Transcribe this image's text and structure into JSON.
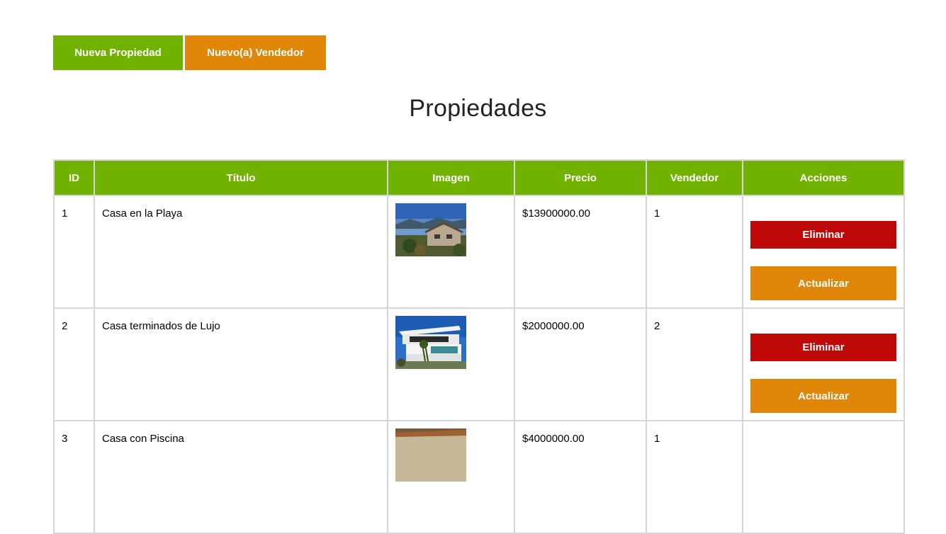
{
  "toolbar": {
    "new_property_label": "Nueva Propiedad",
    "new_seller_label": "Nuevo(a) Vendedor"
  },
  "page": {
    "title": "Propiedades"
  },
  "table": {
    "headers": [
      "ID",
      "Título",
      "Imagen",
      "Precio",
      "Vendedor",
      "Acciones"
    ],
    "rows": [
      {
        "id": "1",
        "titulo": "Casa en la Playa",
        "precio": "$13900000.00",
        "vendedor": "1",
        "delete_label": "Eliminar",
        "update_label": "Actualizar"
      },
      {
        "id": "2",
        "titulo": "Casa terminados de Lujo",
        "precio": "$2000000.00",
        "vendedor": "2",
        "delete_label": "Eliminar",
        "update_label": "Actualizar"
      },
      {
        "id": "3",
        "titulo": "Casa con Piscina",
        "precio": "$4000000.00",
        "vendedor": "1"
      }
    ]
  },
  "colors": {
    "green": "#71b100",
    "orange": "#e08709",
    "red": "#bf0909"
  }
}
